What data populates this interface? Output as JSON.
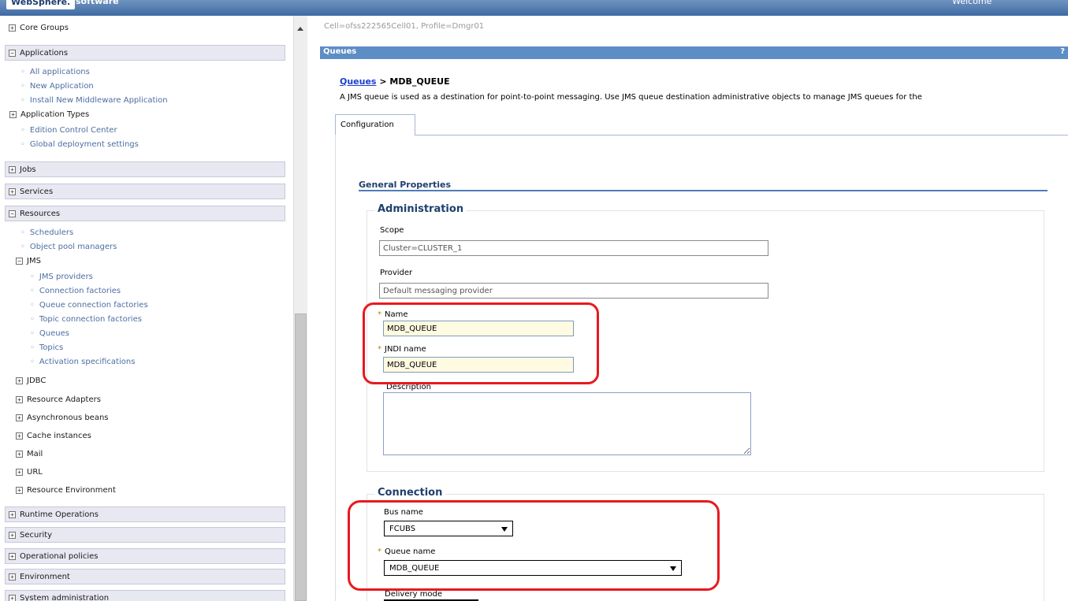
{
  "header": {
    "brand": "WebSphere.",
    "software": "software",
    "welcome": "Welcome"
  },
  "nav": {
    "core_groups": "Core Groups",
    "applications": {
      "label": "Applications",
      "items": [
        "All applications",
        "New Application",
        "Install New Middleware Application"
      ],
      "application_types": "Application Types",
      "items2": [
        "Edition Control Center",
        "Global deployment settings"
      ]
    },
    "jobs": "Jobs",
    "services": "Services",
    "resources": {
      "label": "Resources",
      "items": [
        "Schedulers",
        "Object pool managers"
      ],
      "jms": {
        "label": "JMS",
        "items": [
          "JMS providers",
          "Connection factories",
          "Queue connection factories",
          "Topic connection factories",
          "Queues",
          "Topics",
          "Activation specifications"
        ]
      },
      "groups": [
        "JDBC",
        "Resource Adapters",
        "Asynchronous beans",
        "Cache instances",
        "Mail",
        "URL",
        "Resource Environment"
      ]
    },
    "runtime_operations": "Runtime Operations",
    "security": "Security",
    "operational_policies": "Operational policies",
    "environment": "Environment",
    "system_administration": "System administration"
  },
  "content": {
    "cell_info": "Cell=ofss222565Cell01, Profile=Dmgr01",
    "panel_title": "Queues",
    "help": "?",
    "breadcrumb": {
      "link": "Queues",
      "separator": " > ",
      "current": "MDB_QUEUE"
    },
    "description": "A JMS queue is used as a destination for point-to-point messaging. Use JMS queue destination administrative objects to manage JMS queues for the",
    "tab": "Configuration",
    "general_properties": "General Properties",
    "administration": {
      "legend": "Administration",
      "scope_label": "Scope",
      "scope_value": "Cluster=CLUSTER_1",
      "provider_label": "Provider",
      "provider_value": "Default messaging provider",
      "required_marker": "*",
      "name_label": "Name",
      "name_value": "MDB_QUEUE",
      "jndi_label": "JNDI name",
      "jndi_value": "MDB_QUEUE",
      "description_label": "Description"
    },
    "connection": {
      "legend": "Connection",
      "bus_label": "Bus name",
      "bus_value": "FCUBS",
      "queue_label": "Queue name",
      "queue_value": "MDB_QUEUE",
      "delivery_label": "Delivery mode"
    }
  },
  "colors": {
    "highlight": "#e8191f",
    "title_bar": "#5d8dc5",
    "link": "#1b3fd0"
  }
}
